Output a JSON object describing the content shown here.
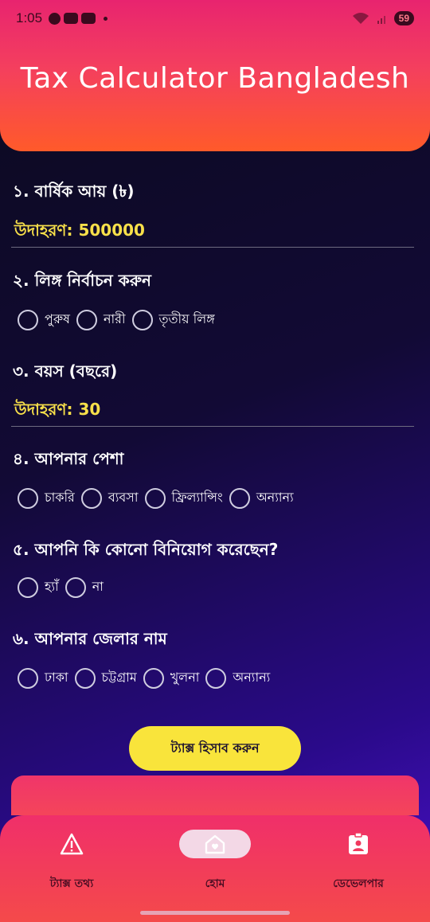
{
  "status": {
    "time": "1:05",
    "battery": "59"
  },
  "app": {
    "title": "Tax Calculator Bangladesh"
  },
  "form": {
    "income": {
      "label": "১. বার্ষিক আয় (৳)",
      "placeholder": "উদাহরণ: 500000"
    },
    "gender": {
      "label": "২. লিঙ্গ নির্বাচন করুন",
      "options": [
        "পুরুষ",
        "নারী",
        "তৃতীয় লিঙ্গ"
      ]
    },
    "age": {
      "label": "৩. বয়স (বছরে)",
      "placeholder": "উদাহরণ: 30"
    },
    "profession": {
      "label": "৪. আপনার পেশা",
      "options": [
        "চাকরি",
        "ব্যবসা",
        "ফ্রিল্যান্সিং",
        "অন্যান্য"
      ]
    },
    "investment": {
      "label": "৫. আপনি কি কোনো বিনিয়োগ করেছেন?",
      "options": [
        "হ্যাঁ",
        "না"
      ]
    },
    "district": {
      "label": "৬. আপনার জেলার নাম",
      "options": [
        "ঢাকা",
        "চট্টগ্রাম",
        "খুলনা",
        "অন্যান্য"
      ]
    }
  },
  "calculate_button": "ট্যাক্স হিসাব করুন",
  "nav": {
    "items": [
      {
        "label": "ট্যাক্স তথ্য",
        "icon": "warning-icon"
      },
      {
        "label": "হোম",
        "icon": "home-icon",
        "active": true
      },
      {
        "label": "ডেভেলপার",
        "icon": "badge-icon"
      }
    ]
  },
  "colors": {
    "accent": "#f9e43b",
    "header": "#f43f5e",
    "nav_active": "#f3d8e6"
  }
}
